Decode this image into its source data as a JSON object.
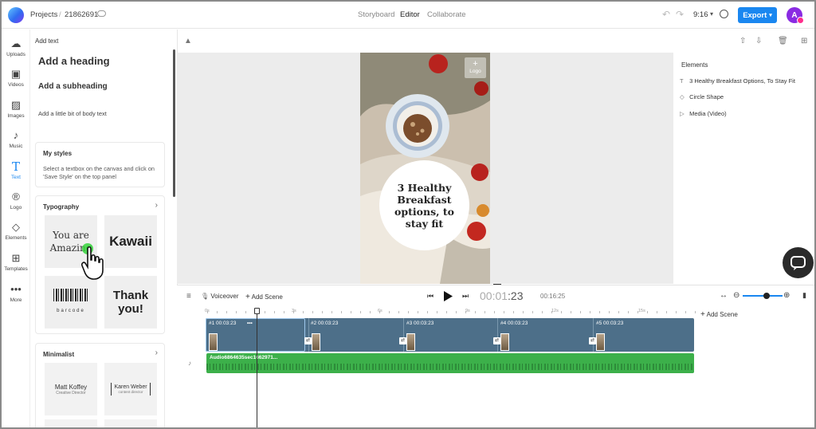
{
  "header": {
    "breadcrumb_projects": "Projects",
    "breadcrumb_sep": "/",
    "project_id": "21862691",
    "modes": [
      "Storyboard",
      "Editor",
      "Collaborate"
    ],
    "ratio": "9:16",
    "export_label": "Export",
    "avatar_initial": "A",
    "accent": "#1a87f0"
  },
  "rail": [
    {
      "label": "Uploads",
      "icon": "upload-icon"
    },
    {
      "label": "Videos",
      "icon": "video-icon"
    },
    {
      "label": "Images",
      "icon": "image-icon"
    },
    {
      "label": "Music",
      "icon": "music-icon"
    },
    {
      "label": "Text",
      "icon": "text-icon"
    },
    {
      "label": "Logo",
      "icon": "logo-icon"
    },
    {
      "label": "Elements",
      "icon": "shapes-icon"
    },
    {
      "label": "Templates",
      "icon": "templates-icon"
    },
    {
      "label": "More",
      "icon": "more-icon"
    }
  ],
  "text_panel": {
    "title": "Add text",
    "heading": "Add a heading",
    "subheading": "Add a subheading",
    "body": "Add a little bit of body text",
    "my_styles_title": "My styles",
    "my_styles_text": "Select a textbox on the canvas and click on 'Save Style' on the top panel",
    "typography_title": "Typography",
    "typography_tiles": [
      "You are Amazing",
      "Kawaii",
      "barcode",
      "Thank you!"
    ],
    "minimalist_title": "Minimalist",
    "minimalist_tiles": [
      {
        "name": "Matt Koffey",
        "role": "Creative Director"
      },
      {
        "name": "Karen Weber",
        "role": "content director"
      }
    ]
  },
  "canvas": {
    "logo_label": "Logo",
    "headline": "3 Healthy Breakfast options, to stay fit"
  },
  "elements_panel": {
    "title": "Elements",
    "items": [
      {
        "label": "3 Healthy Breakfast Options, To Stay Fit",
        "icon": "text-icon"
      },
      {
        "label": "Circle Shape",
        "icon": "shape-icon"
      },
      {
        "label": "Media (Video)",
        "icon": "play-icon"
      }
    ]
  },
  "timeline": {
    "voiceover": "Voiceover",
    "add_scene": "Add Scene",
    "add_scene_right": "Add Scene",
    "current_time_dim": "00:01",
    "current_time_bright": ":23",
    "total_time": "00:16:25",
    "ruler": [
      "0s",
      "3s",
      "6s",
      "9s",
      "12s",
      "15s"
    ],
    "clips": [
      {
        "label": "#1 00:03:23"
      },
      {
        "label": "#2 00:03:23"
      },
      {
        "label": "#3 00:03:23"
      },
      {
        "label": "#4 00:03:23"
      },
      {
        "label": "#5 00:03:23"
      }
    ],
    "audio_label": "Audio6864635sec1662971...",
    "audio_color": "#3cb04a",
    "track_color": "#4d6f89"
  }
}
